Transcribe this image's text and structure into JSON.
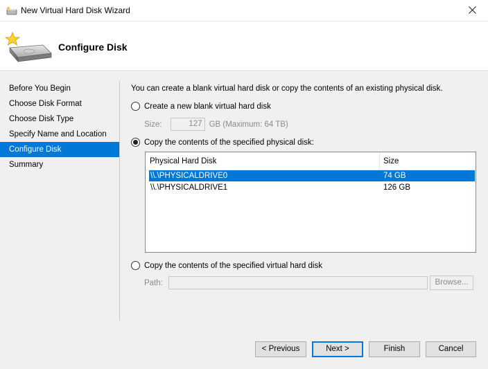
{
  "window": {
    "title": "New Virtual Hard Disk Wizard",
    "title_icon": "virtual-disk-icon",
    "close_icon": "close-icon"
  },
  "header": {
    "title": "Configure Disk",
    "icon": "hard-disk-icon"
  },
  "nav": {
    "items": [
      {
        "label": "Before You Begin",
        "active": false
      },
      {
        "label": "Choose Disk Format",
        "active": false
      },
      {
        "label": "Choose Disk Type",
        "active": false
      },
      {
        "label": "Specify Name and Location",
        "active": false
      },
      {
        "label": "Configure Disk",
        "active": true
      },
      {
        "label": "Summary",
        "active": false
      }
    ]
  },
  "content": {
    "intro": "You can create a blank virtual hard disk or copy the contents of an existing physical disk.",
    "option_new": {
      "label": "Create a new blank virtual hard disk",
      "selected": false,
      "size_label": "Size:",
      "size_value": "127",
      "size_suffix": "GB (Maximum: 64 TB)"
    },
    "option_physical": {
      "label": "Copy the contents of the specified physical disk:",
      "selected": true,
      "columns": [
        "Physical Hard Disk",
        "Size"
      ],
      "rows": [
        {
          "disk": "\\\\.\\PHYSICALDRIVE0",
          "size": "74 GB",
          "selected": true
        },
        {
          "disk": "\\\\.\\PHYSICALDRIVE1",
          "size": "126 GB",
          "selected": false
        }
      ]
    },
    "option_virtual": {
      "label": "Copy the contents of the specified virtual hard disk",
      "selected": false,
      "path_label": "Path:",
      "path_value": "",
      "browse_label": "Browse..."
    }
  },
  "buttons": {
    "previous": "< Previous",
    "next": "Next >",
    "finish": "Finish",
    "cancel": "Cancel"
  },
  "colors": {
    "accent": "#0078d7",
    "panel_bg": "#f0f0f0"
  }
}
